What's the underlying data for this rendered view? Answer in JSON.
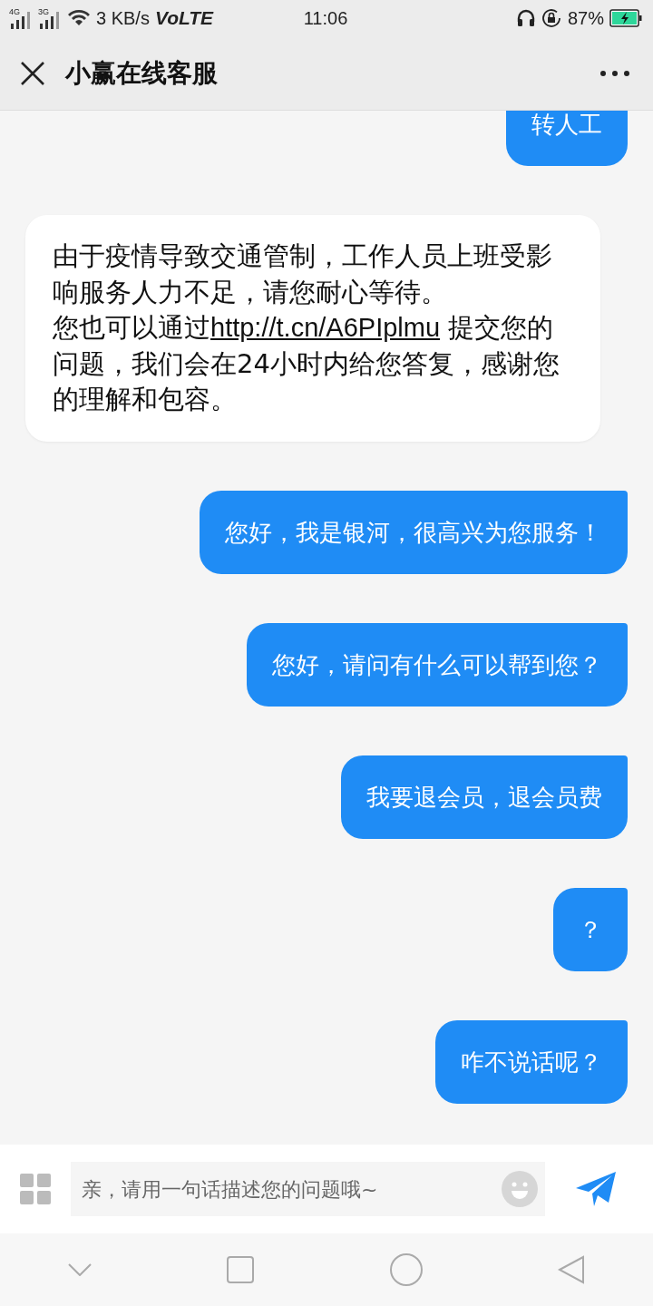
{
  "status_bar": {
    "network_1": "4G",
    "network_2": "3G",
    "speed": "3 KB/s",
    "volte": "VoLTE",
    "time": "11:06",
    "battery": "87%"
  },
  "header": {
    "title": "小赢在线客服"
  },
  "messages": [
    {
      "kind": "user",
      "text": "转人工"
    },
    {
      "kind": "bot",
      "paragraphs": [
        {
          "text": "由于疫情导致交通管制，工作人员上班受影响服务人力不足，请您耐心等待。"
        },
        {
          "text": "您也可以通过",
          "link": "http://t.cn/A6PIplmu",
          "after": " 提交您的问题，我们会在24小时内给您答复，感谢您的理解和包容。"
        }
      ]
    },
    {
      "kind": "user",
      "text": "您好，我是银河，很高兴为您服务！"
    },
    {
      "kind": "user",
      "text": "您好，请问有什么可以帮到您？"
    },
    {
      "kind": "user",
      "text": "我要退会员，退会员费"
    },
    {
      "kind": "user",
      "text": "？"
    },
    {
      "kind": "user",
      "text": "咋不说话呢？"
    }
  ],
  "input": {
    "placeholder": "亲，请用一句话描述您的问题哦~"
  }
}
